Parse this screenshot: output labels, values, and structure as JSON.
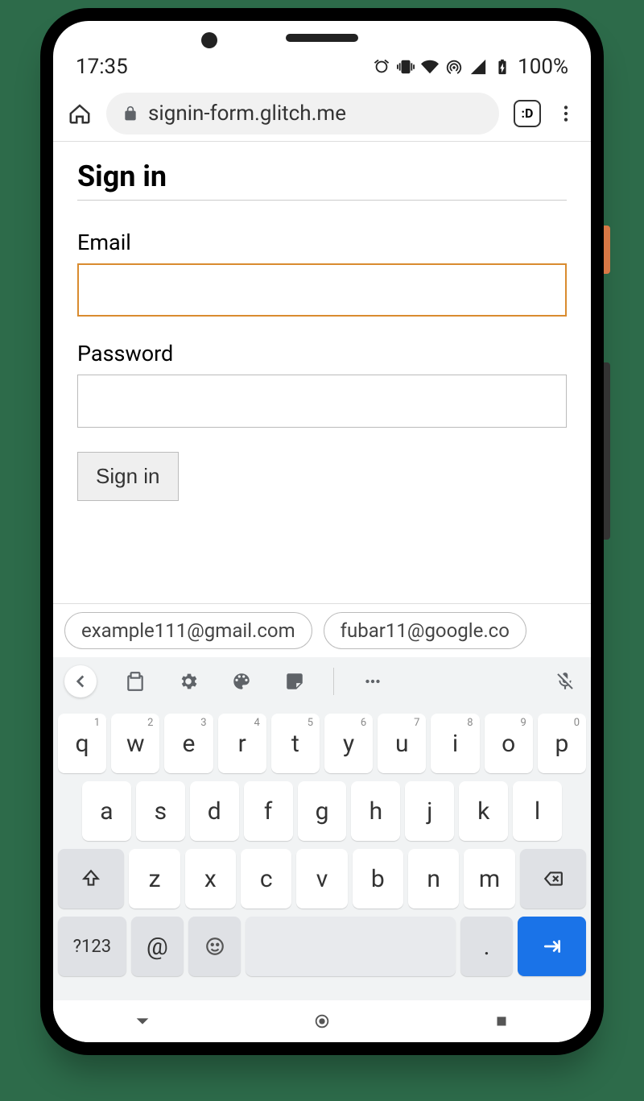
{
  "status": {
    "time": "17:35",
    "battery": "100%"
  },
  "browser": {
    "url": "signin-form.glitch.me",
    "tab_count": ":D"
  },
  "page": {
    "title": "Sign in",
    "email_label": "Email",
    "password_label": "Password",
    "signin_button": "Sign in"
  },
  "suggestions": [
    "example111@gmail.com",
    "fubar11@google.co"
  ],
  "keyboard": {
    "row1": [
      {
        "k": "q",
        "s": "1"
      },
      {
        "k": "w",
        "s": "2"
      },
      {
        "k": "e",
        "s": "3"
      },
      {
        "k": "r",
        "s": "4"
      },
      {
        "k": "t",
        "s": "5"
      },
      {
        "k": "y",
        "s": "6"
      },
      {
        "k": "u",
        "s": "7"
      },
      {
        "k": "i",
        "s": "8"
      },
      {
        "k": "o",
        "s": "9"
      },
      {
        "k": "p",
        "s": "0"
      }
    ],
    "row2": [
      "a",
      "s",
      "d",
      "f",
      "g",
      "h",
      "j",
      "k",
      "l"
    ],
    "row3": [
      "z",
      "x",
      "c",
      "v",
      "b",
      "n",
      "m"
    ],
    "symbols_key": "?123",
    "at_key": "@",
    "period_key": "."
  }
}
